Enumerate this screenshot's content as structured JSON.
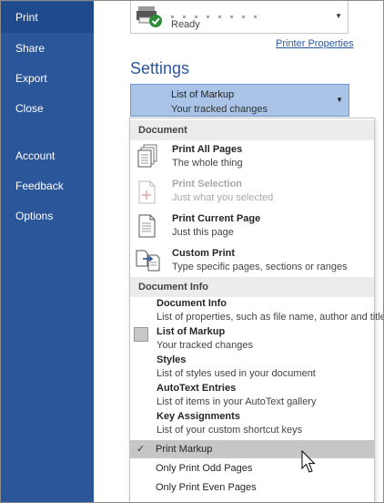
{
  "sidebar": {
    "items": [
      {
        "label": "Print",
        "active": true
      },
      {
        "label": "Share"
      },
      {
        "label": "Export"
      },
      {
        "label": "Close"
      },
      {
        "label": "Account"
      },
      {
        "label": "Feedback"
      },
      {
        "label": "Options"
      }
    ]
  },
  "printer": {
    "status": "Ready",
    "properties_link": "Printer Properties"
  },
  "settings": {
    "heading": "Settings",
    "selected": {
      "title": "List of Markup",
      "description": "Your tracked changes"
    }
  },
  "menu": {
    "document_header": "Document",
    "document_items": [
      {
        "title": "Print All Pages",
        "description": "The whole thing",
        "icon": "all-pages-icon"
      },
      {
        "title": "Print Selection",
        "description": "Just what you selected",
        "icon": "selection-icon",
        "disabled": true
      },
      {
        "title": "Print Current Page",
        "description": "Just this page",
        "icon": "current-page-icon"
      },
      {
        "title": "Custom Print",
        "description": "Type specific pages, sections or ranges",
        "icon": "custom-print-icon"
      }
    ],
    "info_header": "Document Info",
    "info_items": [
      {
        "title": "Document Info",
        "description": "List of properties, such as file name, author and title"
      },
      {
        "title": "List of Markup",
        "description": "Your tracked changes",
        "selected": true
      },
      {
        "title": "Styles",
        "description": "List of styles used in your document"
      },
      {
        "title": "AutoText Entries",
        "description": "List of items in your AutoText gallery"
      },
      {
        "title": "Key Assignments",
        "description": "List of your custom shortcut keys"
      }
    ],
    "options": [
      {
        "label": "Print Markup",
        "checked": true,
        "highlighted": true
      },
      {
        "label": "Only Print Odd Pages",
        "checked": false
      },
      {
        "label": "Only Print Even Pages",
        "checked": false
      }
    ],
    "check_glyph": "✓"
  },
  "colors": {
    "sidebar_bg": "#2b579a",
    "accent": "#2b579a",
    "selected_dropdown_bg": "#a9c4e6",
    "highlight_row": "#c6c6c6"
  }
}
